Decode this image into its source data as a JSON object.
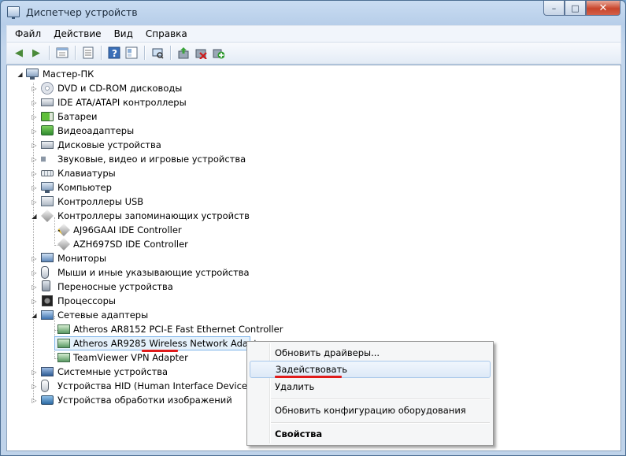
{
  "window": {
    "title": "Диспетчер устройств",
    "buttons": {
      "minimize": "–",
      "maximize": "□",
      "close": "✕"
    }
  },
  "menu": {
    "file": "Файл",
    "action": "Действие",
    "view": "Вид",
    "help": "Справка"
  },
  "toolbar": {
    "icons": [
      "back-icon",
      "forward-icon",
      "up-level-icon",
      "properties-icon",
      "help-icon",
      "scan-hardware-icon",
      "update-driver-icon",
      "uninstall-icon",
      "enable-device-icon"
    ]
  },
  "tree": {
    "root": "Мастер-ПК",
    "items": [
      {
        "label": "DVD и CD-ROM дисководы",
        "expanded": false
      },
      {
        "label": "IDE ATA/ATAPI контроллеры",
        "expanded": false
      },
      {
        "label": "Батареи",
        "expanded": false
      },
      {
        "label": "Видеоадаптеры",
        "expanded": false
      },
      {
        "label": "Дисковые устройства",
        "expanded": false
      },
      {
        "label": "Звуковые, видео и игровые устройства",
        "expanded": false
      },
      {
        "label": "Клавиатуры",
        "expanded": false
      },
      {
        "label": "Компьютер",
        "expanded": false
      },
      {
        "label": "Контроллеры USB",
        "expanded": false
      },
      {
        "label": "Контроллеры запоминающих устройств",
        "expanded": true,
        "children": [
          "AJ96GAAI IDE Controller",
          "AZH697SD IDE Controller"
        ]
      },
      {
        "label": "Мониторы",
        "expanded": false
      },
      {
        "label": "Мыши и иные указывающие устройства",
        "expanded": false
      },
      {
        "label": "Переносные устройства",
        "expanded": false
      },
      {
        "label": "Процессоры",
        "expanded": false
      },
      {
        "label": "Сетевые адаптеры",
        "expanded": true,
        "children": [
          "Atheros AR8152 PCI-E Fast Ethernet Controller",
          "Atheros AR9285 Wireless Network Adapter",
          "TeamViewer VPN Adapter"
        ]
      },
      {
        "label": "Системные устройства",
        "expanded": false
      },
      {
        "label": "Устройства HID (Human Interface Devices)",
        "expanded": false
      },
      {
        "label": "Устройства обработки изображений",
        "expanded": false
      }
    ]
  },
  "context_menu": {
    "update_drivers": "Обновить драйверы...",
    "enable": "Задействовать",
    "delete": "Удалить",
    "scan_hardware": "Обновить конфигурацию оборудования",
    "properties": "Свойства"
  },
  "colors": {
    "highlight_underline": "#e01b1b",
    "selection_bg": "#e5f1fb",
    "selection_border": "#7eb4ea"
  }
}
